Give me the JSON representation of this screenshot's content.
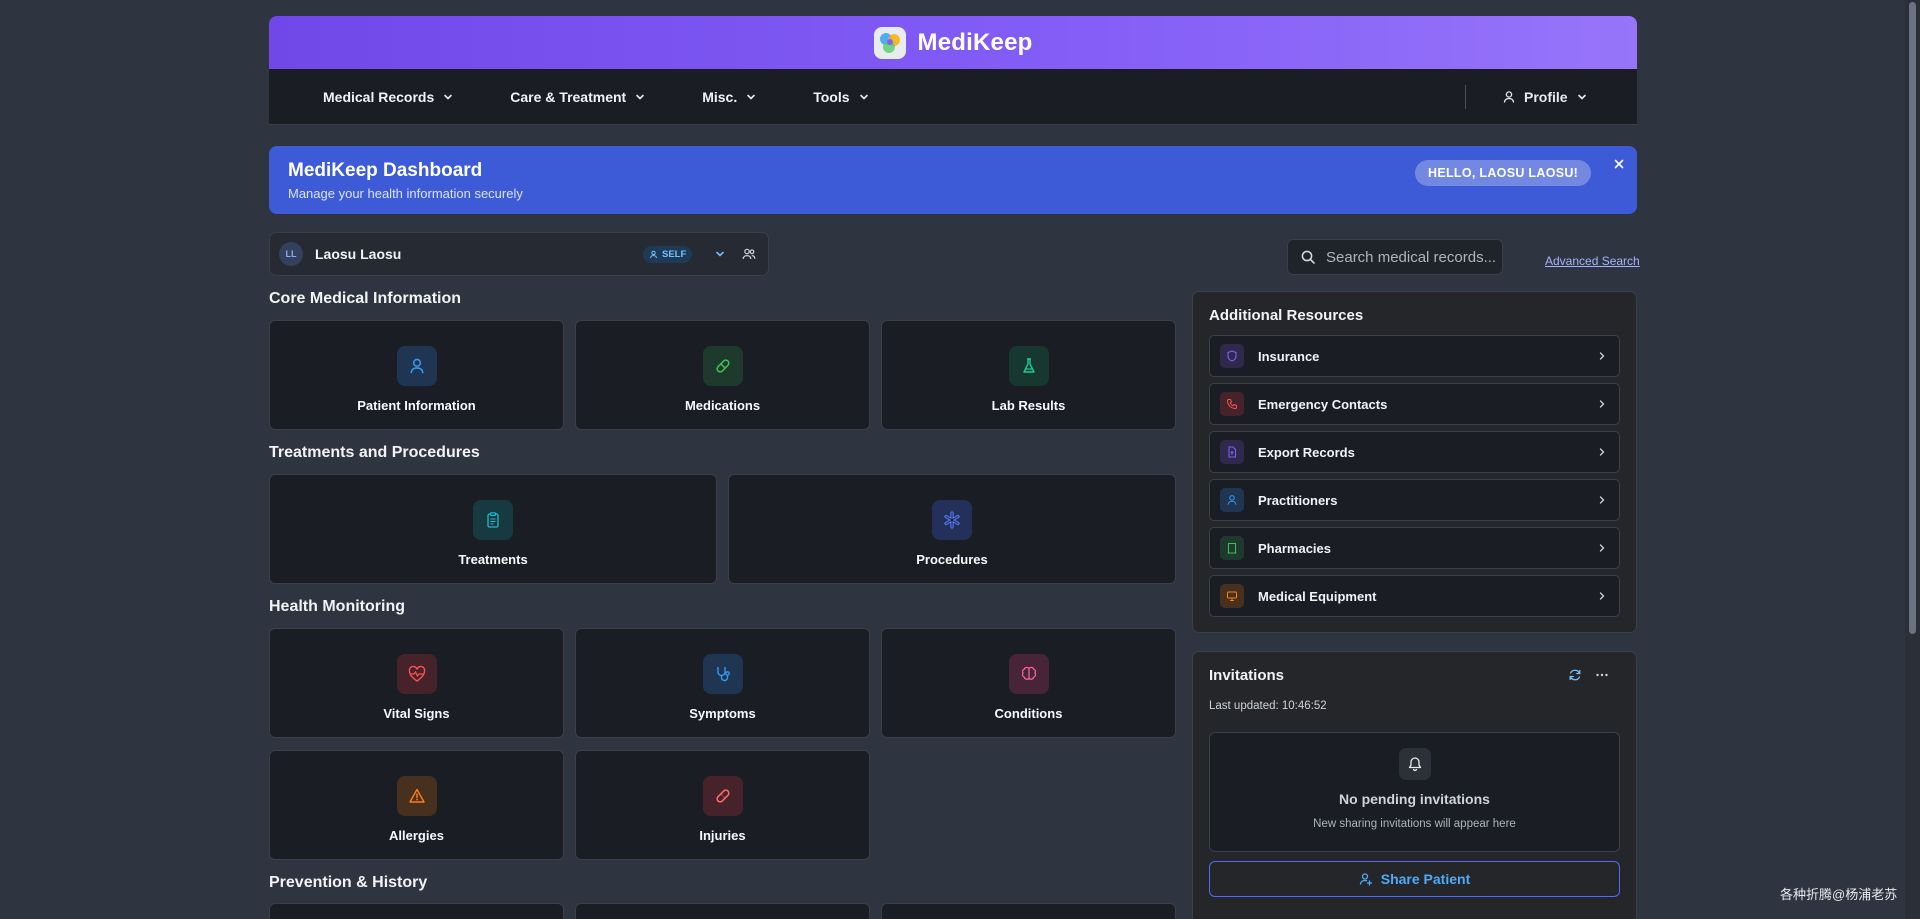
{
  "app": {
    "title": "MediKeep"
  },
  "nav": {
    "items": [
      {
        "label": "Medical Records"
      },
      {
        "label": "Care & Treatment"
      },
      {
        "label": "Misc."
      },
      {
        "label": "Tools"
      }
    ],
    "profile_label": "Profile"
  },
  "banner": {
    "title": "MediKeep Dashboard",
    "subtitle": "Manage your health information securely",
    "greeting": "HELLO, LAOSU LAOSU!"
  },
  "patient": {
    "initials": "LL",
    "name": "Laosu Laosu",
    "badge": "SELF"
  },
  "search": {
    "placeholder": "Search medical records...",
    "advanced_label": "Advanced Search"
  },
  "sections": [
    {
      "title": "Core Medical Information",
      "cards": [
        {
          "label": "Patient Information",
          "icon": "user-icon",
          "color": "#339af0"
        },
        {
          "label": "Medications",
          "icon": "pill-icon",
          "color": "#40c057"
        },
        {
          "label": "Lab Results",
          "icon": "flask-icon",
          "color": "#20c997"
        }
      ]
    },
    {
      "title": "Treatments and Procedures",
      "cards": [
        {
          "label": "Treatments",
          "icon": "clipboard-icon",
          "color": "#22b8cf"
        },
        {
          "label": "Procedures",
          "icon": "medical-cross-icon",
          "color": "#5c7cfa"
        }
      ]
    },
    {
      "title": "Health Monitoring",
      "cards": [
        {
          "label": "Vital Signs",
          "icon": "heart-pulse-icon",
          "color": "#fa5252"
        },
        {
          "label": "Symptoms",
          "icon": "stethoscope-icon",
          "color": "#339af0"
        },
        {
          "label": "Conditions",
          "icon": "brain-icon",
          "color": "#f06595"
        },
        {
          "label": "Allergies",
          "icon": "alert-triangle-icon",
          "color": "#fd7e14"
        },
        {
          "label": "Injuries",
          "icon": "bandage-icon",
          "color": "#ff6b6b"
        }
      ]
    },
    {
      "title": "Prevention & History",
      "cards": []
    }
  ],
  "resources": {
    "title": "Additional Resources",
    "items": [
      {
        "label": "Insurance",
        "icon": "shield-icon",
        "color": "#845ef7"
      },
      {
        "label": "Emergency Contacts",
        "icon": "phone-icon",
        "color": "#fa5252"
      },
      {
        "label": "Export Records",
        "icon": "file-export-icon",
        "color": "#845ef7"
      },
      {
        "label": "Practitioners",
        "icon": "user-icon",
        "color": "#339af0"
      },
      {
        "label": "Pharmacies",
        "icon": "building-icon",
        "color": "#40c057"
      },
      {
        "label": "Medical Equipment",
        "icon": "device-icon",
        "color": "#fd7e14"
      }
    ]
  },
  "invitations": {
    "title": "Invitations",
    "last_updated": "Last updated: 10:46:52",
    "empty_title": "No pending invitations",
    "empty_subtitle": "New sharing invitations will appear here",
    "share_label": "Share Patient"
  },
  "watermark": "各种折腾@杨浦老苏"
}
